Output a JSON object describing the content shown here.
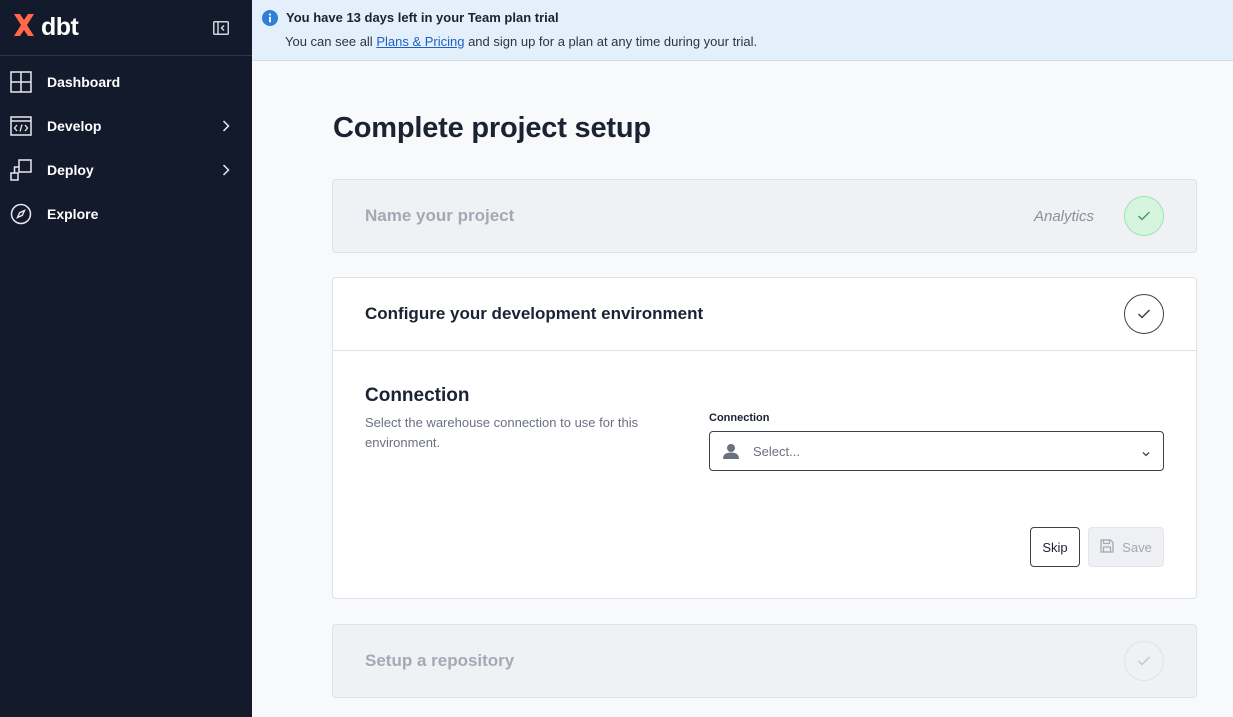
{
  "app": {
    "logo_text": "dbt",
    "brand_color": "#FF694A"
  },
  "sidebar": {
    "items": [
      {
        "label": "Dashboard",
        "icon": "dashboard-grid-icon",
        "has_submenu": false
      },
      {
        "label": "Develop",
        "icon": "code-window-icon",
        "has_submenu": true
      },
      {
        "label": "Deploy",
        "icon": "deploy-icon",
        "has_submenu": true
      },
      {
        "label": "Explore",
        "icon": "compass-icon",
        "has_submenu": false
      }
    ]
  },
  "banner": {
    "title": "You have 13 days left in your Team plan trial",
    "sub_before": "You can see all ",
    "link": "Plans & Pricing",
    "sub_after": " and sign up for a plan at any time during your trial."
  },
  "page": {
    "title": "Complete project setup"
  },
  "steps": [
    {
      "title": "Name your project",
      "value": "Analytics",
      "status": "done"
    },
    {
      "title": "Configure your development environment",
      "status": "active"
    },
    {
      "title": "Setup a repository",
      "status": "pending"
    }
  ],
  "connection": {
    "section_title": "Connection",
    "description": "Select the warehouse connection to use for this environment.",
    "field_label": "Connection",
    "placeholder": "Select...",
    "skip_label": "Skip",
    "save_label": "Save"
  }
}
